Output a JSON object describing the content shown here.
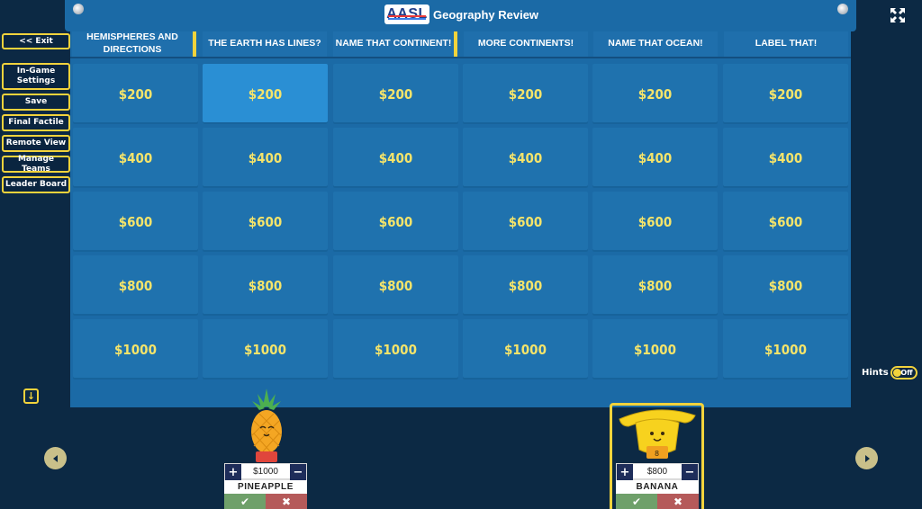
{
  "header": {
    "logo_text": "AASL",
    "title": "Geography Review"
  },
  "menu": {
    "exit": "<< Exit",
    "settings": "In-Game Settings",
    "save": "Save",
    "final": "Final Factile",
    "remote": "Remote View",
    "teams": "Manage Teams",
    "leader": "Leader Board"
  },
  "categories": [
    "HEMISPHERES AND DIRECTIONS",
    "THE EARTH HAS LINES?",
    "NAME THAT CONTINENT!",
    "MORE CONTINENTS!",
    "NAME THAT OCEAN!",
    "LABEL THAT!"
  ],
  "values": [
    "$200",
    "$400",
    "$600",
    "$800",
    "$1000"
  ],
  "hints": {
    "label": "Hints",
    "state": "Off"
  },
  "teams": [
    {
      "name": "PINEAPPLE",
      "score": "$1000"
    },
    {
      "name": "BANANA",
      "score": "$800"
    }
  ],
  "colors": {
    "accent": "#f2d33c",
    "board": "#1b6aa6",
    "cell": "#1f72ae",
    "value_text": "#f5e46a"
  }
}
